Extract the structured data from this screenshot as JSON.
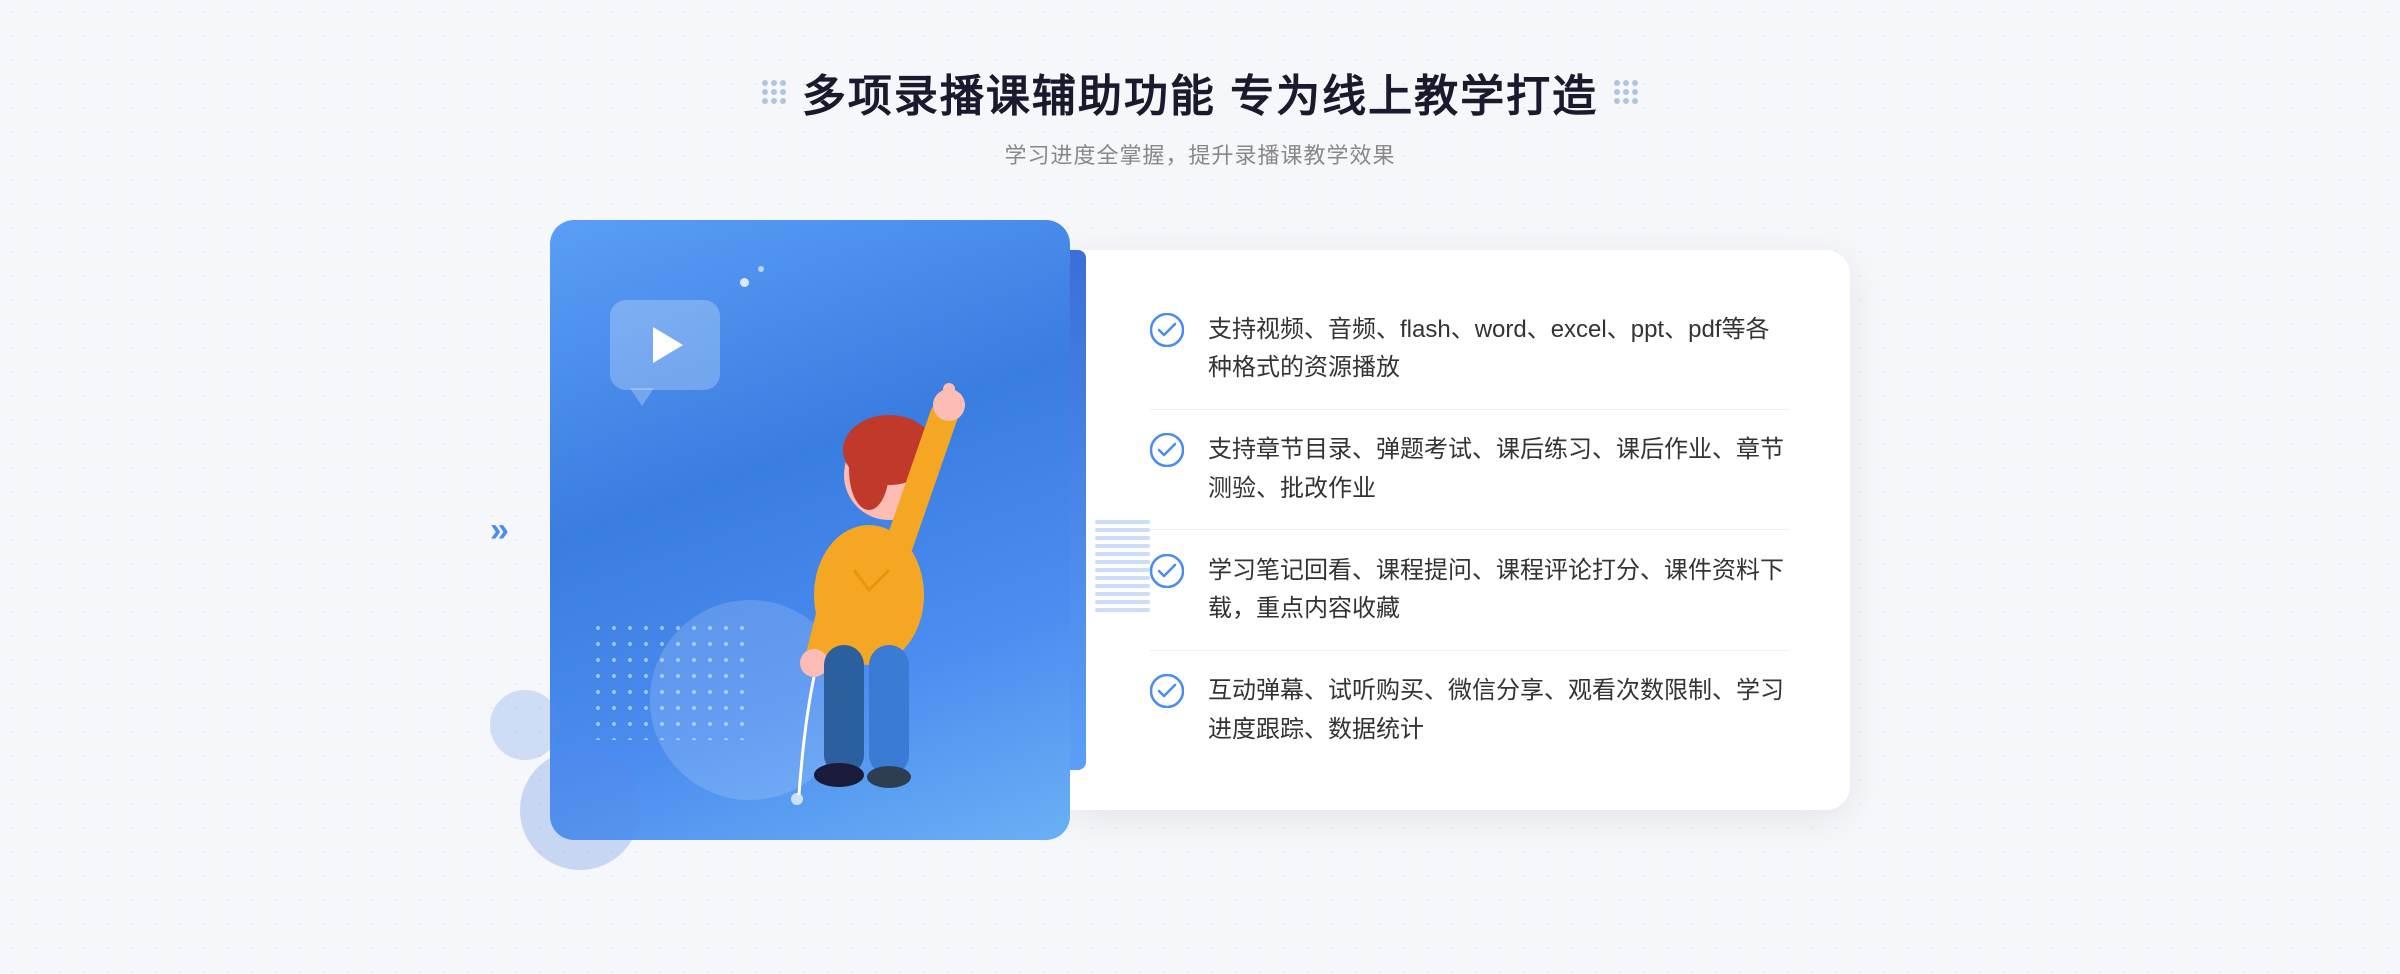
{
  "header": {
    "title": "多项录播课辅助功能 专为线上教学打造",
    "subtitle": "学习进度全掌握，提升录播课教学效果",
    "deco_left_label": "decorative-dots-left",
    "deco_right_label": "decorative-dots-right"
  },
  "features": [
    {
      "id": 1,
      "text": "支持视频、音频、flash、word、excel、ppt、pdf等各种格式的资源播放"
    },
    {
      "id": 2,
      "text": "支持章节目录、弹题考试、课后练习、课后作业、章节测验、批改作业"
    },
    {
      "id": 3,
      "text": "学习笔记回看、课程提问、课程评论打分、课件资料下载，重点内容收藏"
    },
    {
      "id": 4,
      "text": "互动弹幕、试听购买、微信分享、观看次数限制、学习进度跟踪、数据统计"
    }
  ],
  "colors": {
    "primary_blue": "#4a8cf0",
    "dark_blue": "#3a6fd8",
    "light_blue": "#5b9ef7",
    "text_dark": "#1a1a2e",
    "text_gray": "#888888",
    "text_body": "#333333",
    "check_color": "#4a8cf0"
  }
}
